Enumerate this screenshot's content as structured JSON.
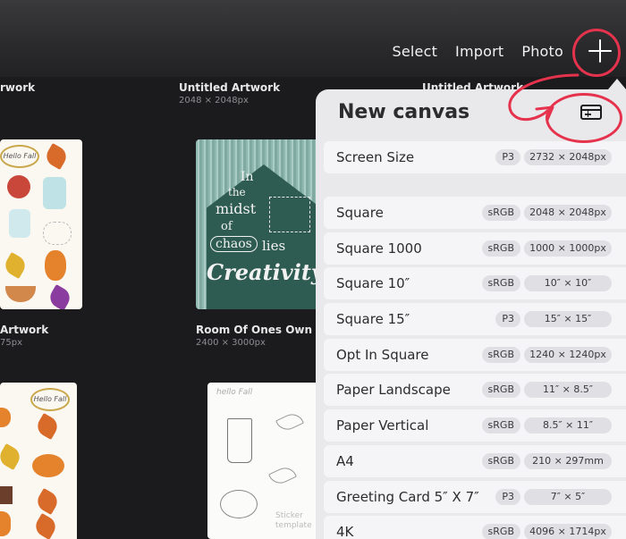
{
  "toolbar": {
    "select_label": "Select",
    "import_label": "Import",
    "photo_label": "Photo"
  },
  "gallery": {
    "items": [
      {
        "title": "rwork",
        "size": ""
      },
      {
        "title": "Untitled Artwork",
        "size": "2048 × 2048px"
      },
      {
        "title": "Untitled Artwork",
        "size": ""
      },
      {
        "title": "Artwork",
        "size": "75px"
      },
      {
        "title": "Room Of Ones Own",
        "size": "2400 × 3000px"
      }
    ],
    "chalk_words": [
      "In",
      "the",
      "midst",
      "of",
      "chaos",
      "lies",
      "Creativity"
    ],
    "sticker_words": [
      "Hello Fall"
    ],
    "sketch_words": [
      "hello Fall",
      "Sticker template"
    ]
  },
  "panel": {
    "title": "New canvas",
    "screen_size": {
      "name": "Screen Size",
      "color_space": "P3",
      "size": "2732 × 2048px"
    },
    "presets": [
      {
        "name": "Square",
        "color_space": "sRGB",
        "size": "2048 × 2048px"
      },
      {
        "name": "Square 1000",
        "color_space": "sRGB",
        "size": "1000 × 1000px"
      },
      {
        "name": "Square 10″",
        "color_space": "sRGB",
        "size": "10″ × 10″"
      },
      {
        "name": "Square 15″",
        "color_space": "P3",
        "size": "15″ × 15″"
      },
      {
        "name": "Opt In Square",
        "color_space": "sRGB",
        "size": "1240 × 1240px"
      },
      {
        "name": "Paper Landscape",
        "color_space": "sRGB",
        "size": "11″ × 8.5″"
      },
      {
        "name": "Paper Vertical",
        "color_space": "sRGB",
        "size": "8.5″ × 11″"
      },
      {
        "name": "A4",
        "color_space": "sRGB",
        "size": "210 × 297mm"
      },
      {
        "name": "Greeting Card 5″ X 7″",
        "color_space": "P3",
        "size": "7″ × 5″"
      },
      {
        "name": "4K",
        "color_space": "sRGB",
        "size": "4096 × 1714px"
      }
    ]
  },
  "colors": {
    "annotation_red": "#e6334d",
    "panel_bg": "#e9e9ec",
    "row_bg": "#f5f5f7"
  }
}
